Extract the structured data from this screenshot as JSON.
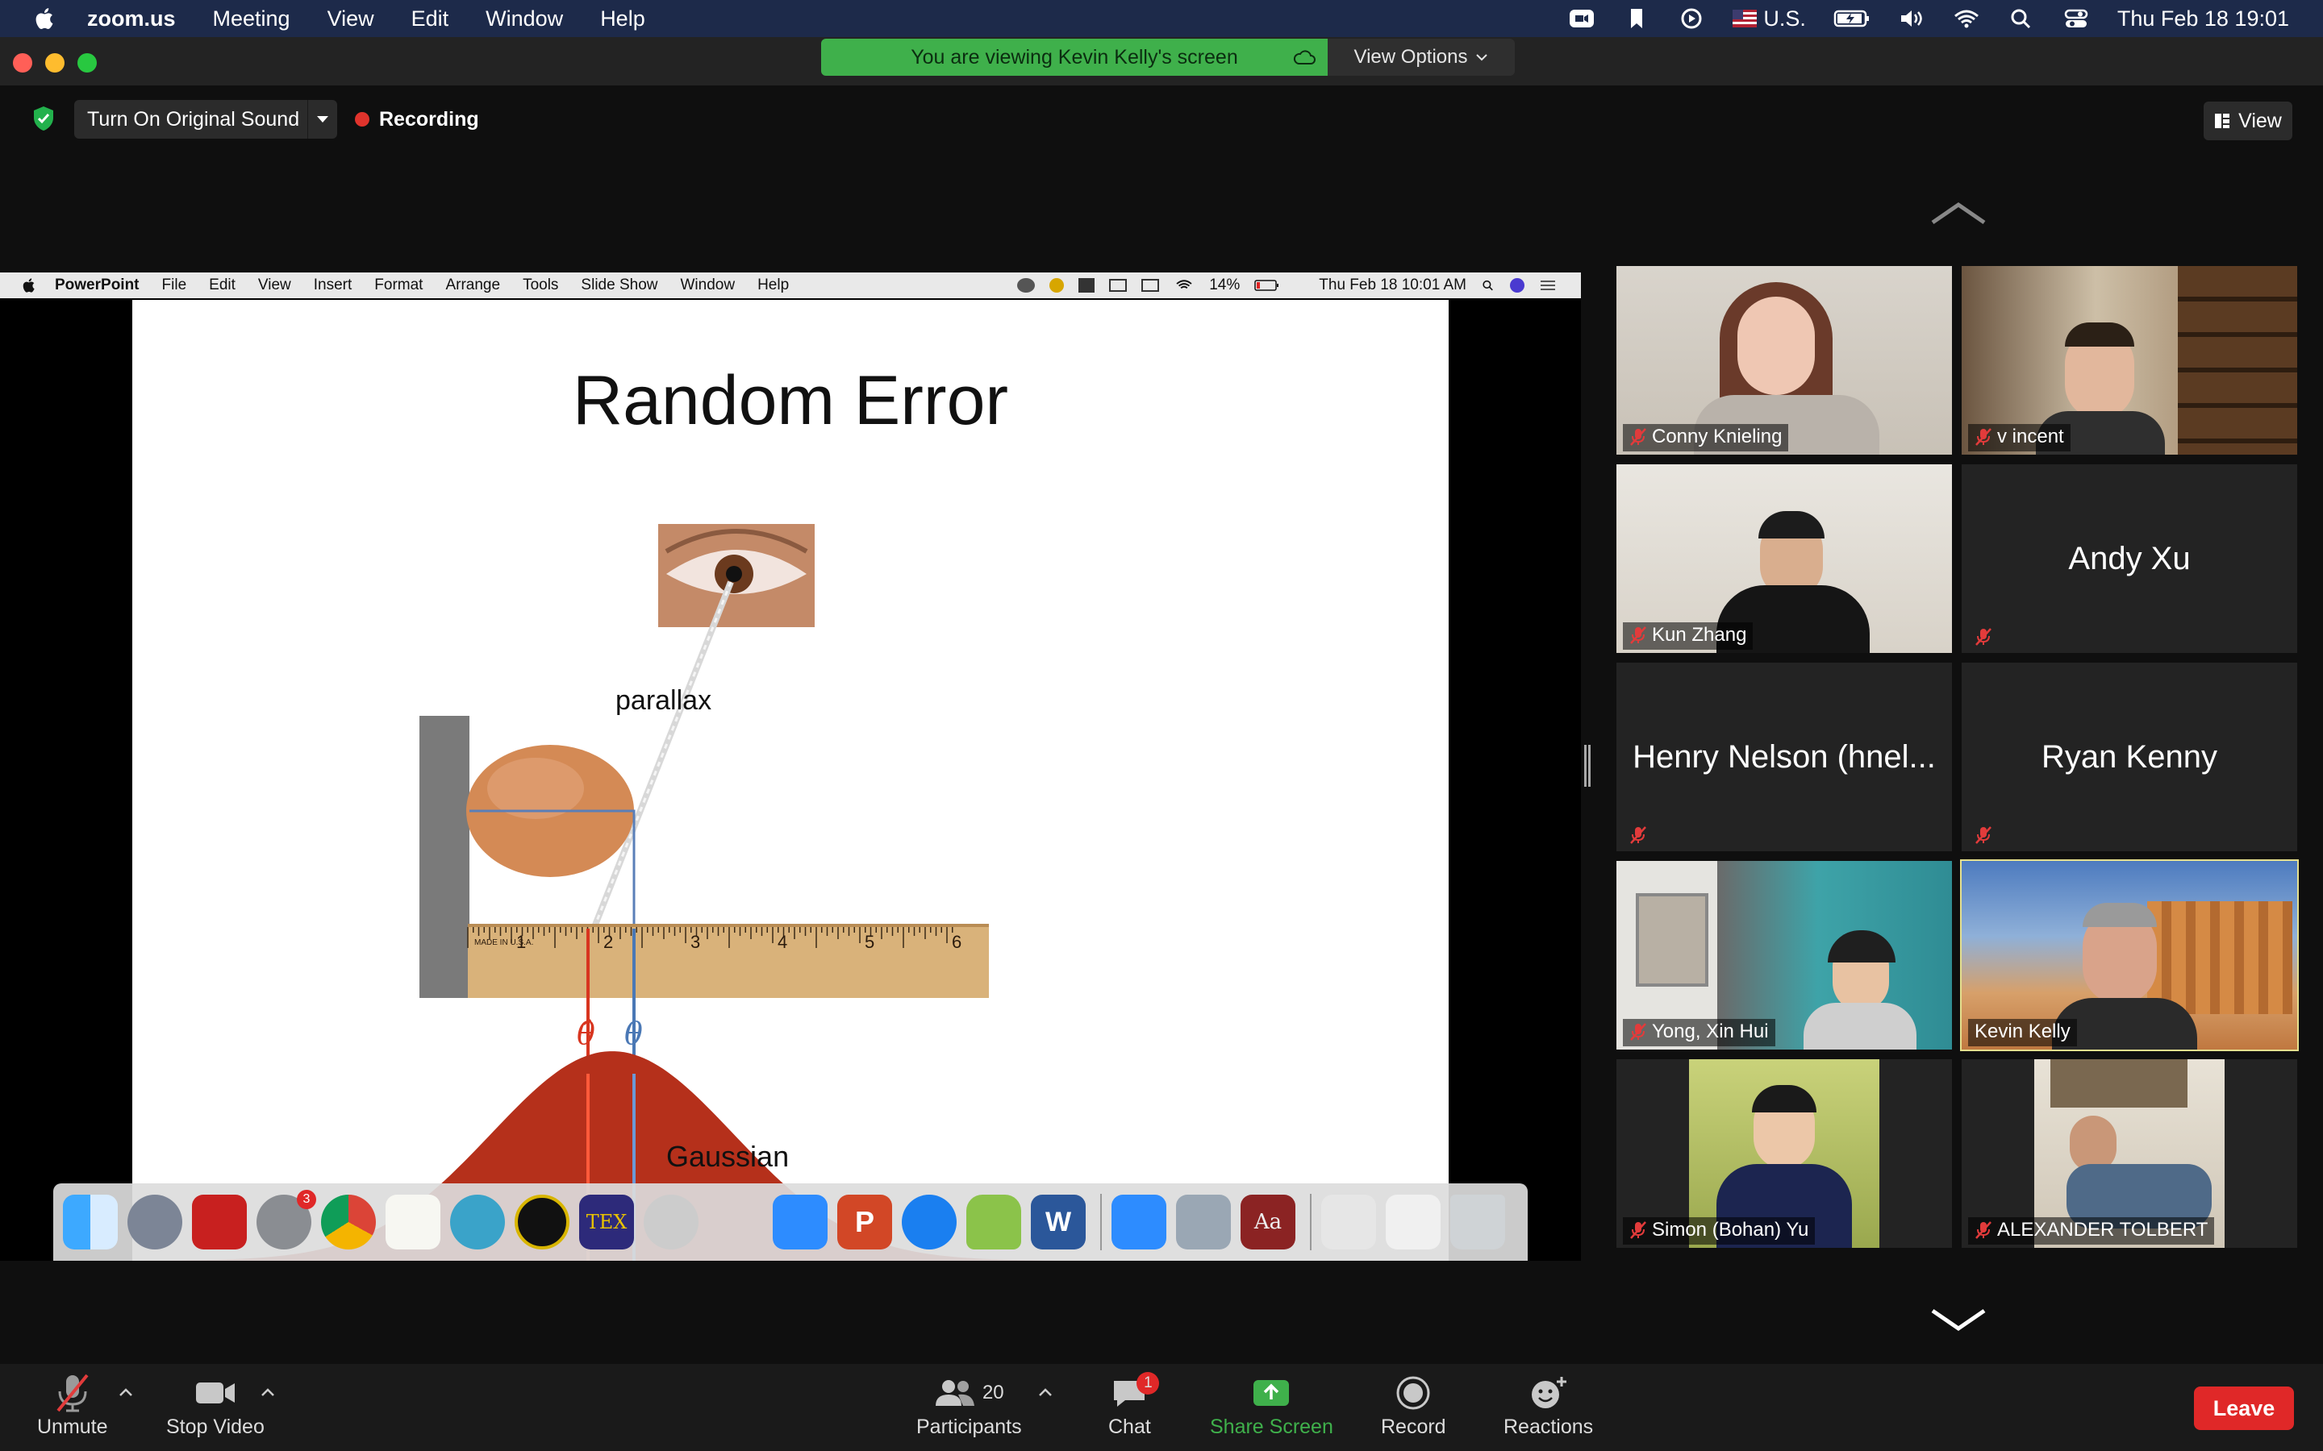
{
  "menubar": {
    "app_name": "zoom.us",
    "items": [
      "Meeting",
      "View",
      "Edit",
      "Window",
      "Help"
    ],
    "input_source": "U.S.",
    "datetime": "Thu Feb 18  19:01"
  },
  "banner": {
    "viewing_text": "You are viewing Kevin Kelly's screen",
    "view_options": "View Options"
  },
  "toolbar": {
    "original_sound": "Turn On Original Sound",
    "recording": "Recording",
    "view": "View"
  },
  "shared_screen": {
    "menubar": {
      "app": "PowerPoint",
      "items": [
        "File",
        "Edit",
        "View",
        "Insert",
        "Format",
        "Arrange",
        "Tools",
        "Slide Show",
        "Window",
        "Help"
      ],
      "battery": "14%",
      "datetime": "Thu Feb 18  10:01 AM"
    },
    "slide": {
      "title": "Random Error",
      "parallax_label": "parallax",
      "gaussian_label": "Gaussian",
      "theta_hat": "θ̂",
      "theta": "θ",
      "ruler_marks": [
        "1",
        "2",
        "3",
        "4",
        "5",
        "6"
      ],
      "ruler_made_in": "MADE IN U.S.A."
    },
    "dock": {
      "settings_badge": "3",
      "latex_label": "TEX",
      "ppt_letter": "P",
      "word_letter": "W",
      "dict_letter": "Aa"
    }
  },
  "participants": [
    {
      "name": "Conny Knieling",
      "muted": true,
      "video": true
    },
    {
      "name": "v incent",
      "muted": true,
      "video": true
    },
    {
      "name": "Kun Zhang",
      "muted": true,
      "video": true
    },
    {
      "name": "Andy Xu",
      "muted": true,
      "video": false
    },
    {
      "name": "Henry Nelson (hnel...",
      "muted": true,
      "video": false
    },
    {
      "name": "Ryan Kenny",
      "muted": true,
      "video": false
    },
    {
      "name": "Yong, Xin Hui",
      "muted": true,
      "video": true
    },
    {
      "name": "Kevin Kelly",
      "muted": false,
      "video": true,
      "active_speaker": true
    },
    {
      "name": "Simon (Bohan) Yu",
      "muted": true,
      "video": true
    },
    {
      "name": "ALEXANDER TOLBERT",
      "muted": true,
      "video": true
    }
  ],
  "bottombar": {
    "unmute": "Unmute",
    "stop_video": "Stop Video",
    "participants": "Participants",
    "participants_count": "20",
    "chat": "Chat",
    "chat_badge": "1",
    "share_screen": "Share Screen",
    "record": "Record",
    "reactions": "Reactions",
    "leave": "Leave"
  },
  "colors": {
    "share_green": "#3fb04b",
    "leave_red": "#e02828",
    "active_speaker": "#e5e08e",
    "slide_red": "#b5301b"
  }
}
